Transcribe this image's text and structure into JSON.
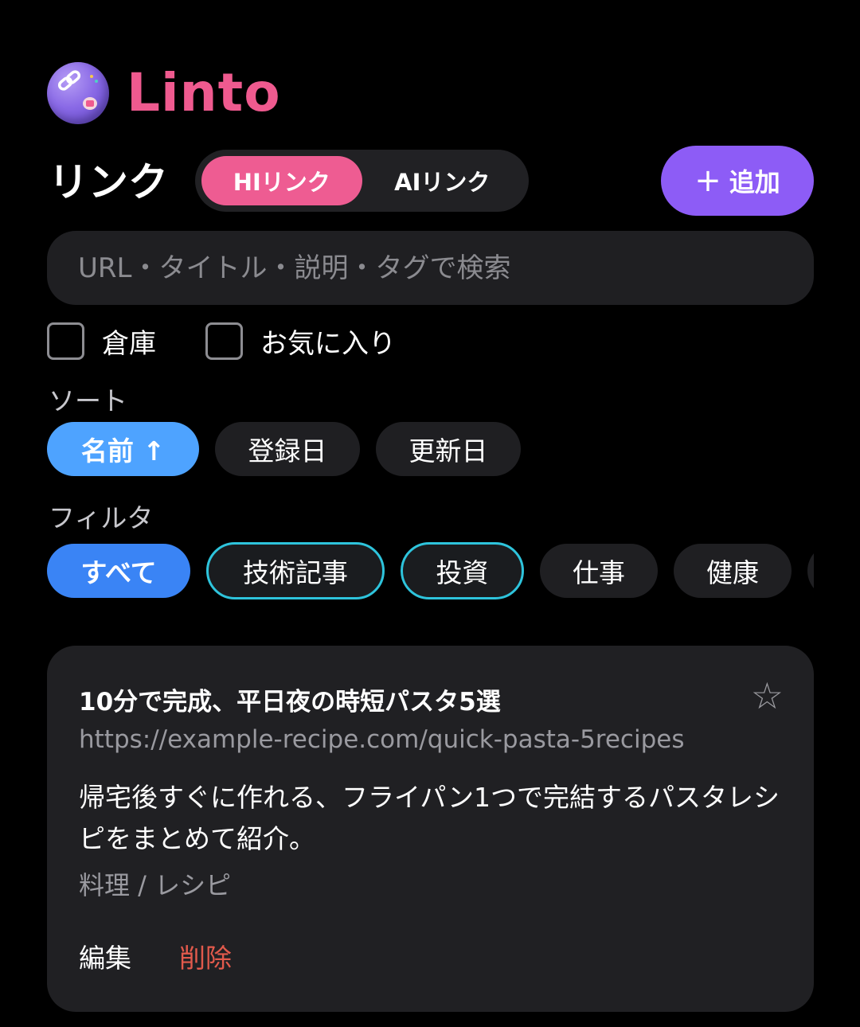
{
  "brand": {
    "name": "Linto"
  },
  "header": {
    "title": "リンク",
    "segments": [
      {
        "label": "HIリンク",
        "active": true
      },
      {
        "label": "AIリンク",
        "active": false
      }
    ],
    "add_button": {
      "icon": "+",
      "label": "追加"
    }
  },
  "search": {
    "placeholder": "URL・タイトル・説明・タグで検索",
    "value": ""
  },
  "checkboxes": [
    {
      "label": "倉庫",
      "checked": false
    },
    {
      "label": "お気に入り",
      "checked": false
    }
  ],
  "sort": {
    "label": "ソート",
    "options": [
      {
        "label": "名前 ↑",
        "active": true
      },
      {
        "label": "登録日",
        "active": false
      },
      {
        "label": "更新日",
        "active": false
      }
    ]
  },
  "filter": {
    "label": "フィルタ",
    "options": [
      {
        "label": "すべて",
        "state": "active"
      },
      {
        "label": "技術記事",
        "state": "outlined"
      },
      {
        "label": "投資",
        "state": "outlined"
      },
      {
        "label": "仕事",
        "state": "default"
      },
      {
        "label": "健康",
        "state": "default"
      }
    ]
  },
  "card": {
    "title": "10分で完成、平日夜の時短パスタ5選",
    "url": "https://example-recipe.com/quick-pasta-5recipes",
    "description": "帰宅後すぐに作れる、フライパン1つで完結するパスタレシピをまとめて紹介。",
    "tags": "料理 / レシピ",
    "favorite_icon": "☆",
    "edit_label": "編集",
    "delete_label": "削除"
  },
  "colors": {
    "background": "#000000",
    "brand": "#ef5a8f",
    "segment_active": "#ee5c92",
    "add_button": "#8d5cf6",
    "sort_active": "#4ea3ff",
    "filter_active": "#3a84f5",
    "filter_outline": "#2ec4dc",
    "delete": "#e25a4c"
  }
}
